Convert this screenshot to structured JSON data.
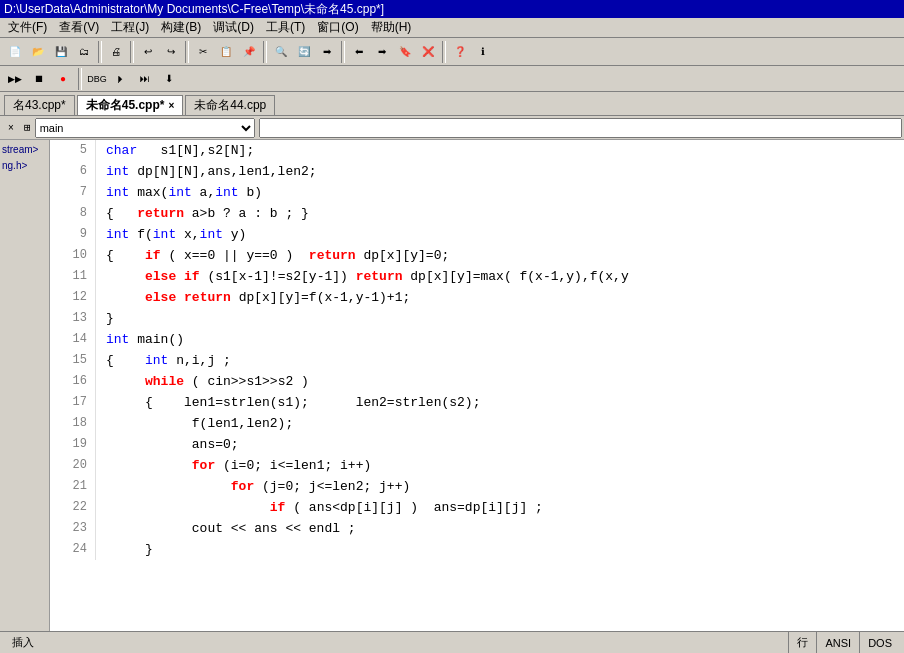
{
  "title_bar": {
    "text": "D:\\UserData\\Administrator\\My Documents\\C-Free\\Temp\\未命名45.cpp*]"
  },
  "menu_bar": {
    "items": [
      "文件(F)",
      "查看(V)",
      "工程(J)",
      "构建(B)",
      "调试(D)",
      "工具(T)",
      "窗口(O)",
      "帮助(H)"
    ]
  },
  "tabs": [
    {
      "label": "名43.cpp*",
      "active": false,
      "closeable": false
    },
    {
      "label": "未命名45.cpp*",
      "active": true,
      "closeable": true
    },
    {
      "label": "未命名44.cpp",
      "active": false,
      "closeable": false
    }
  ],
  "func_bar": {
    "dropdown_value": "main",
    "dropdown_icon": "⊞"
  },
  "sidebar": {
    "items": [
      "stream>",
      "ng.h>"
    ]
  },
  "code": {
    "lines": [
      {
        "num": 5,
        "content": "char   s1[N],s2[N];",
        "tokens": [
          {
            "t": "kw",
            "v": "char"
          },
          {
            "t": "norm",
            "v": "   s1[N],s2[N];"
          }
        ]
      },
      {
        "num": 6,
        "content": "int dp[N][N],ans,len1,len2;",
        "tokens": [
          {
            "t": "kw",
            "v": "int"
          },
          {
            "t": "norm",
            "v": " dp[N][N],ans,len1,len2;"
          }
        ]
      },
      {
        "num": 7,
        "content": "int max(int a,int b)",
        "tokens": [
          {
            "t": "kw",
            "v": "int"
          },
          {
            "t": "norm",
            "v": " max("
          },
          {
            "t": "kw",
            "v": "int"
          },
          {
            "t": "norm",
            "v": " a,"
          },
          {
            "t": "kw",
            "v": "int"
          },
          {
            "t": "norm",
            "v": " b)"
          }
        ]
      },
      {
        "num": 8,
        "content": "{    return a>b ? a : b ; }",
        "tokens": [
          {
            "t": "norm",
            "v": "{   "
          },
          {
            "t": "ret",
            "v": "return"
          },
          {
            "t": "norm",
            "v": " a>b ? a : b ; }"
          }
        ]
      },
      {
        "num": 9,
        "content": "int f(int x,int y)",
        "tokens": [
          {
            "t": "kw",
            "v": "int"
          },
          {
            "t": "norm",
            "v": " f("
          },
          {
            "t": "kw",
            "v": "int"
          },
          {
            "t": "norm",
            "v": " x,"
          },
          {
            "t": "kw",
            "v": "int"
          },
          {
            "t": "norm",
            "v": " y)"
          }
        ]
      },
      {
        "num": 10,
        "content": "{    if ( x==0 || y==0 )  return dp[x][y]=0;",
        "tokens": [
          {
            "t": "norm",
            "v": "{    "
          },
          {
            "t": "ret",
            "v": "if"
          },
          {
            "t": "norm",
            "v": " ( x==0 || y==0 )  "
          },
          {
            "t": "ret",
            "v": "return"
          },
          {
            "t": "norm",
            "v": " dp[x][y]=0;"
          }
        ]
      },
      {
        "num": 11,
        "content": "     else if (s1[x-1]!=s2[y-1]) return dp[x][y]=max( f(x-1,y),f(x,y",
        "tokens": [
          {
            "t": "norm",
            "v": "     "
          },
          {
            "t": "ret",
            "v": "else"
          },
          {
            "t": "norm",
            "v": " "
          },
          {
            "t": "ret",
            "v": "if"
          },
          {
            "t": "norm",
            "v": " (s1[x-1]!=s2[y-1]) "
          },
          {
            "t": "ret",
            "v": "return"
          },
          {
            "t": "norm",
            "v": " dp[x][y]=max( f(x-1,y),f(x,y"
          }
        ]
      },
      {
        "num": 12,
        "content": "     else return dp[x][y]=f(x-1,y-1)+1;",
        "tokens": [
          {
            "t": "norm",
            "v": "     "
          },
          {
            "t": "ret",
            "v": "else"
          },
          {
            "t": "norm",
            "v": " "
          },
          {
            "t": "ret",
            "v": "return"
          },
          {
            "t": "norm",
            "v": " dp[x][y]=f(x-1,y-1)+1;"
          }
        ]
      },
      {
        "num": 13,
        "content": "}",
        "tokens": [
          {
            "t": "norm",
            "v": "}"
          }
        ]
      },
      {
        "num": 14,
        "content": "int main()",
        "tokens": [
          {
            "t": "kw",
            "v": "int"
          },
          {
            "t": "norm",
            "v": " main()"
          }
        ]
      },
      {
        "num": 15,
        "content": "{    int n,i,j ;",
        "tokens": [
          {
            "t": "norm",
            "v": "{    "
          },
          {
            "t": "kw",
            "v": "int"
          },
          {
            "t": "norm",
            "v": " n,i,j ;"
          }
        ]
      },
      {
        "num": 16,
        "content": "     while ( cin>>s1>>s2 )",
        "tokens": [
          {
            "t": "norm",
            "v": "     "
          },
          {
            "t": "ret",
            "v": "while"
          },
          {
            "t": "norm",
            "v": " ( cin>>s1>>s2 )"
          }
        ]
      },
      {
        "num": 17,
        "content": "     {    len1=strlen(s1);      len2=strlen(s2);",
        "tokens": [
          {
            "t": "norm",
            "v": "     {    len1=strlen(s1);      len2=strlen(s2);"
          }
        ]
      },
      {
        "num": 18,
        "content": "           f(len1,len2);",
        "tokens": [
          {
            "t": "norm",
            "v": "           f(len1,len2);"
          }
        ]
      },
      {
        "num": 19,
        "content": "           ans=0;",
        "tokens": [
          {
            "t": "norm",
            "v": "           ans=0;"
          }
        ]
      },
      {
        "num": 20,
        "content": "           for (i=0; i<=len1; i++)",
        "tokens": [
          {
            "t": "norm",
            "v": "           "
          },
          {
            "t": "ret",
            "v": "for"
          },
          {
            "t": "norm",
            "v": " (i=0; i<=len1; i++)"
          }
        ]
      },
      {
        "num": 21,
        "content": "                for (j=0; j<=len2; j++)",
        "tokens": [
          {
            "t": "norm",
            "v": "                "
          },
          {
            "t": "ret",
            "v": "for"
          },
          {
            "t": "norm",
            "v": " (j=0; j<=len2; j++)"
          }
        ]
      },
      {
        "num": 22,
        "content": "                     if ( ans<dp[i][j] )  ans=dp[i][j] ;",
        "tokens": [
          {
            "t": "norm",
            "v": "                     "
          },
          {
            "t": "ret",
            "v": "if"
          },
          {
            "t": "norm",
            "v": " ( ans<dp[i][j] )  ans=dp[i][j] ;"
          }
        ]
      },
      {
        "num": 23,
        "content": "           cout << ans << endl ;",
        "tokens": [
          {
            "t": "norm",
            "v": "           cout << ans << endl ;"
          }
        ]
      },
      {
        "num": 24,
        "content": "     }",
        "tokens": [
          {
            "t": "norm",
            "v": "     }"
          }
        ]
      }
    ]
  },
  "status_bar": {
    "mode": "插入",
    "line_label": "行",
    "encoding": "ANSI",
    "line_ending": "DOS"
  }
}
